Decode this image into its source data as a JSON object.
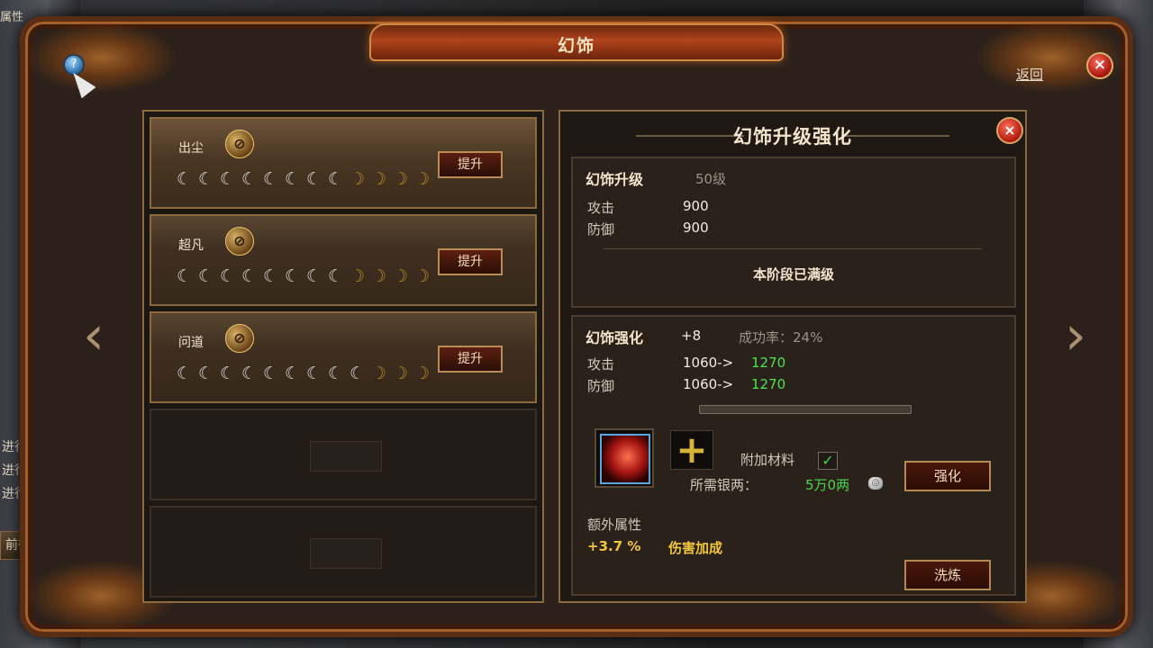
{
  "window": {
    "title": "幻饰",
    "back_label": "返回",
    "help_icon": "help-icon",
    "close_icon": "close-icon"
  },
  "background": {
    "top_tab": "属性",
    "side_lines": [
      "进行",
      "进行",
      "进行"
    ],
    "goto_label": "前往"
  },
  "list": [
    {
      "name": "出尘",
      "filled": 8,
      "total": 12,
      "button": "提升"
    },
    {
      "name": "超凡",
      "filled": 8,
      "total": 12,
      "button": "提升"
    },
    {
      "name": "问道",
      "filled": 9,
      "total": 12,
      "button": "提升"
    }
  ],
  "detail": {
    "title": "幻饰升级强化",
    "upgrade": {
      "heading": "幻饰升级",
      "level": "50级",
      "attack_label": "攻击",
      "attack_value": "900",
      "defense_label": "防御",
      "defense_value": "900",
      "max_text": "本阶段已满级"
    },
    "enhance": {
      "heading": "幻饰强化",
      "plus": "+8",
      "rate": "成功率：24%",
      "attack_label": "攻击",
      "attack_from": "1060->",
      "attack_to": "1270",
      "defense_label": "防御",
      "defense_from": "1060->",
      "defense_to": "1270",
      "extra_material_label": "附加材料",
      "silver_label": "所需银两：",
      "silver_amount": "5万0两",
      "enhance_button": "强化",
      "extra_attr_label": "额外属性",
      "bonus_value": "+3.7 %",
      "bonus_name": "伤害加成",
      "refine_button": "洗炼"
    }
  },
  "colors": {
    "green": "#4ce34c",
    "gold": "#f2c63c"
  }
}
